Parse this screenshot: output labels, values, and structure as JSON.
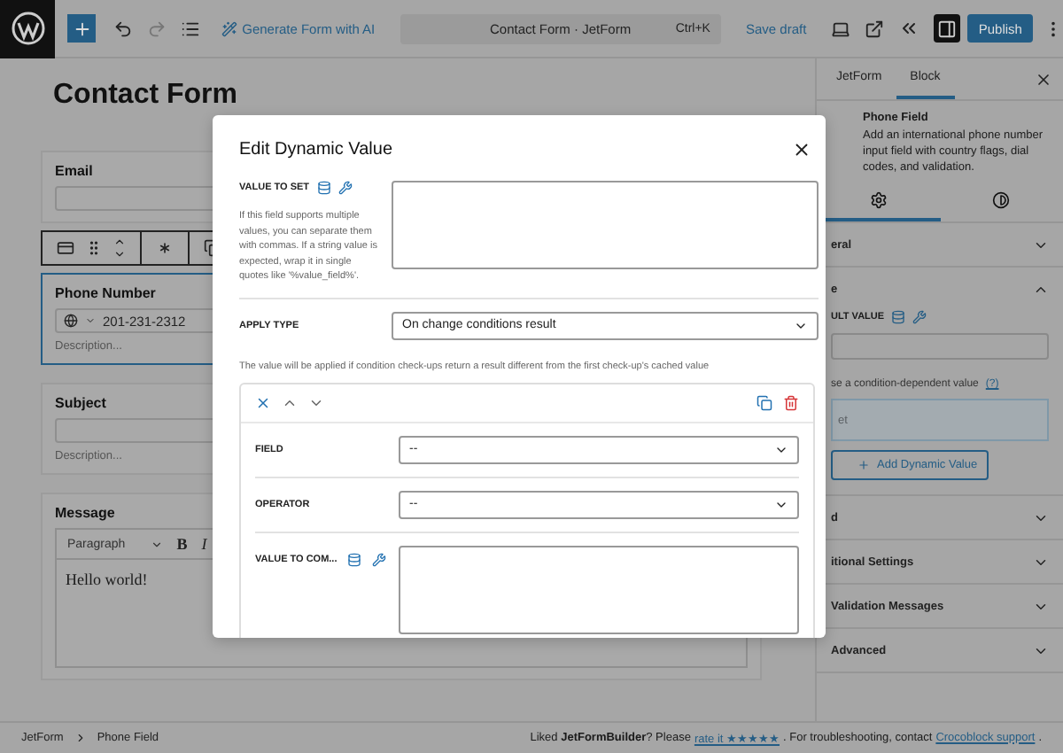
{
  "top_bar": {
    "generate": "Generate Form with AI",
    "command": {
      "title": "Contact Form · JetForm",
      "shortcut": "Ctrl+K"
    },
    "save": "Save draft",
    "publish": "Publish"
  },
  "editor": {
    "title": "Contact Form",
    "fields": [
      {
        "kind": "text",
        "label": "Email",
        "selected": false
      },
      {
        "kind": "phone",
        "label": "Phone Number",
        "value": "201-231-2312",
        "description": "Description...",
        "selected": true
      },
      {
        "kind": "text",
        "label": "Subject",
        "description": "Description...",
        "selected": false
      },
      {
        "kind": "richtext",
        "label": "Message",
        "format": "Paragraph",
        "bold": "B",
        "italic": "I",
        "content": "Hello world!",
        "selected": false
      }
    ]
  },
  "sidebar": {
    "tabs": [
      {
        "label": "JetForm",
        "selected": false
      },
      {
        "label": "Block",
        "selected": true
      }
    ],
    "block_title": "Phone Field",
    "block_description": "Add an international phone number input field with country flags, dial codes, and validation.",
    "settings_tabs": [
      {
        "kind": "settings",
        "selected": true
      },
      {
        "kind": "styles",
        "selected": false
      }
    ],
    "panels": [
      {
        "title": "eral",
        "expanded": false
      },
      {
        "title": "e",
        "expanded": true,
        "default_label": "ULT VALUE",
        "condition_text": "se a condition-dependent value",
        "help": "(?)",
        "placeholder": "et",
        "add_button": "Add Dynamic Value"
      },
      {
        "title": "d",
        "expanded": false
      },
      {
        "title": "itional Settings",
        "expanded": false
      },
      {
        "title": "Validation Messages",
        "expanded": false
      },
      {
        "title": "Advanced",
        "expanded": false
      }
    ]
  },
  "modal": {
    "title": "Edit Dynamic Value",
    "value_to_set": {
      "label": "VALUE TO SET",
      "hint": "If this field supports multiple values, you can separate them with commas. If a string value is expected, wrap it in single quotes like '%value_field%'."
    },
    "apply_type": {
      "label": "APPLY TYPE",
      "value": "On change conditions result"
    },
    "note": "The value will be applied if condition check-ups return a result different from the first check-up's cached value",
    "condition": {
      "field": {
        "label": "FIELD",
        "value": "--"
      },
      "operator": {
        "label": "OPERATOR",
        "value": "--"
      },
      "compare": {
        "label": "VALUE TO COM..."
      }
    }
  },
  "status_bar": {
    "breadcrumbs": [
      "JetForm",
      "Phone Field"
    ],
    "message": [
      {
        "kind": "text",
        "text": "Liked **JetFormBuilder**? Please"
      },
      {
        "kind": "link",
        "text": "rate it ★★★★★"
      },
      {
        "kind": "text",
        "text": ". For troubleshooting, contact"
      },
      {
        "kind": "link",
        "text": "Crocoblock support"
      },
      {
        "kind": "text",
        "text": "."
      }
    ]
  }
}
